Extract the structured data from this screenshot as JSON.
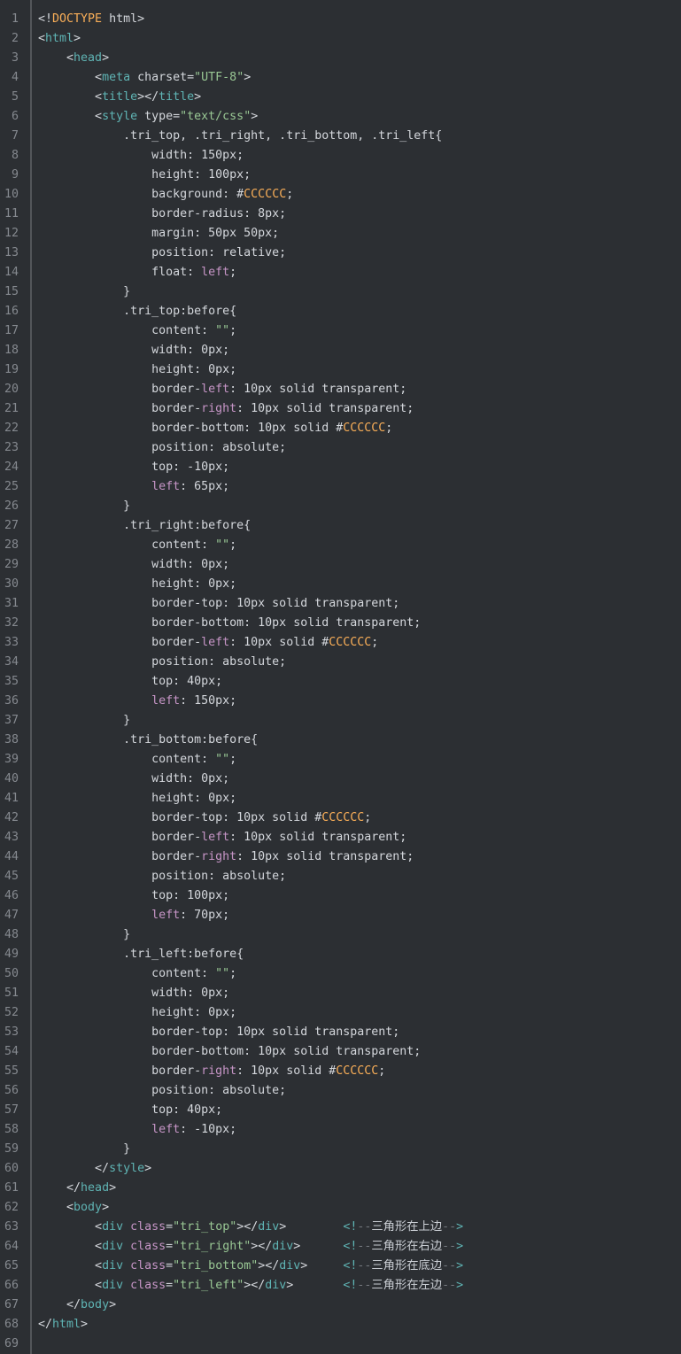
{
  "editor": {
    "colors": {
      "background": "#2c2f33",
      "default_text": "#d4d7dc",
      "tag": "#5fb4b4",
      "string": "#99c794",
      "orange": "#f9ae58",
      "purple": "#c695c6",
      "comment_dash": "#73777d",
      "comment_text": "#c9cdd3",
      "line_number": "#85898f",
      "gutter_divider": "#53565a"
    },
    "lines": [
      {
        "n": "1",
        "tokens": [
          [
            "w",
            "<!"
          ],
          [
            "orn",
            "DOCTYPE"
          ],
          [
            "w",
            " html>"
          ]
        ]
      },
      {
        "n": "2",
        "tokens": [
          [
            "w",
            "<"
          ],
          [
            "tag",
            "html"
          ],
          [
            "w",
            ">"
          ]
        ]
      },
      {
        "n": "3",
        "tokens": [
          [
            "w",
            "    <"
          ],
          [
            "tag",
            "head"
          ],
          [
            "w",
            ">"
          ]
        ]
      },
      {
        "n": "4",
        "tokens": [
          [
            "w",
            "        <"
          ],
          [
            "tag",
            "meta"
          ],
          [
            "w",
            " charset="
          ],
          [
            "str",
            "\"UTF-8\""
          ],
          [
            "w",
            ">"
          ]
        ]
      },
      {
        "n": "5",
        "tokens": [
          [
            "w",
            "        <"
          ],
          [
            "tag",
            "title"
          ],
          [
            "w",
            "></"
          ],
          [
            "tag",
            "title"
          ],
          [
            "w",
            ">"
          ]
        ]
      },
      {
        "n": "6",
        "tokens": [
          [
            "w",
            "        <"
          ],
          [
            "tag",
            "style"
          ],
          [
            "w",
            " type="
          ],
          [
            "str",
            "\"text/css\""
          ],
          [
            "w",
            ">"
          ]
        ]
      },
      {
        "n": "7",
        "tokens": [
          [
            "w",
            "            .tri_top, .tri_right, .tri_bottom, .tri_left{"
          ]
        ]
      },
      {
        "n": "8",
        "tokens": [
          [
            "w",
            "                width: 150px;"
          ]
        ]
      },
      {
        "n": "9",
        "tokens": [
          [
            "w",
            "                height: 100px;"
          ]
        ]
      },
      {
        "n": "10",
        "tokens": [
          [
            "w",
            "                background: #"
          ],
          [
            "orn",
            "CCCCCC"
          ],
          [
            "w",
            ";"
          ]
        ]
      },
      {
        "n": "11",
        "tokens": [
          [
            "w",
            "                border-radius: 8px;"
          ]
        ]
      },
      {
        "n": "12",
        "tokens": [
          [
            "w",
            "                margin: 50px 50px;"
          ]
        ]
      },
      {
        "n": "13",
        "tokens": [
          [
            "w",
            "                position: relative;"
          ]
        ]
      },
      {
        "n": "14",
        "tokens": [
          [
            "w",
            "                float: "
          ],
          [
            "pur",
            "left"
          ],
          [
            "w",
            ";"
          ]
        ]
      },
      {
        "n": "15",
        "tokens": [
          [
            "w",
            "            }"
          ]
        ]
      },
      {
        "n": "16",
        "tokens": [
          [
            "w",
            "            .tri_top:before{"
          ]
        ]
      },
      {
        "n": "17",
        "tokens": [
          [
            "w",
            "                content: "
          ],
          [
            "str",
            "\"\""
          ],
          [
            "w",
            ";"
          ]
        ]
      },
      {
        "n": "18",
        "tokens": [
          [
            "w",
            "                width: 0px;"
          ]
        ]
      },
      {
        "n": "19",
        "tokens": [
          [
            "w",
            "                height: 0px;"
          ]
        ]
      },
      {
        "n": "20",
        "tokens": [
          [
            "w",
            "                border-"
          ],
          [
            "pur",
            "left"
          ],
          [
            "w",
            ": 10px solid transparent;"
          ]
        ]
      },
      {
        "n": "21",
        "tokens": [
          [
            "w",
            "                border-"
          ],
          [
            "pur",
            "right"
          ],
          [
            "w",
            ": 10px solid transparent;"
          ]
        ]
      },
      {
        "n": "22",
        "tokens": [
          [
            "w",
            "                border-bottom: 10px solid #"
          ],
          [
            "orn",
            "CCCCCC"
          ],
          [
            "w",
            ";"
          ]
        ]
      },
      {
        "n": "23",
        "tokens": [
          [
            "w",
            "                position: absolute;"
          ]
        ]
      },
      {
        "n": "24",
        "tokens": [
          [
            "w",
            "                top: -10px;"
          ]
        ]
      },
      {
        "n": "25",
        "tokens": [
          [
            "w",
            "                "
          ],
          [
            "pur",
            "left"
          ],
          [
            "w",
            ": 65px;"
          ]
        ]
      },
      {
        "n": "26",
        "tokens": [
          [
            "w",
            "            }"
          ]
        ]
      },
      {
        "n": "27",
        "tokens": [
          [
            "w",
            "            .tri_right:before{"
          ]
        ]
      },
      {
        "n": "28",
        "tokens": [
          [
            "w",
            "                content: "
          ],
          [
            "str",
            "\"\""
          ],
          [
            "w",
            ";"
          ]
        ]
      },
      {
        "n": "29",
        "tokens": [
          [
            "w",
            "                width: 0px;"
          ]
        ]
      },
      {
        "n": "30",
        "tokens": [
          [
            "w",
            "                height: 0px;"
          ]
        ]
      },
      {
        "n": "31",
        "tokens": [
          [
            "w",
            "                border-top: 10px solid transparent;"
          ]
        ]
      },
      {
        "n": "32",
        "tokens": [
          [
            "w",
            "                border-bottom: 10px solid transparent;"
          ]
        ]
      },
      {
        "n": "33",
        "tokens": [
          [
            "w",
            "                border-"
          ],
          [
            "pur",
            "left"
          ],
          [
            "w",
            ": 10px solid #"
          ],
          [
            "orn",
            "CCCCCC"
          ],
          [
            "w",
            ";"
          ]
        ]
      },
      {
        "n": "34",
        "tokens": [
          [
            "w",
            "                position: absolute;"
          ]
        ]
      },
      {
        "n": "35",
        "tokens": [
          [
            "w",
            "                top: 40px;"
          ]
        ]
      },
      {
        "n": "36",
        "tokens": [
          [
            "w",
            "                "
          ],
          [
            "pur",
            "left"
          ],
          [
            "w",
            ": 150px;"
          ]
        ]
      },
      {
        "n": "37",
        "tokens": [
          [
            "w",
            "            }"
          ]
        ]
      },
      {
        "n": "38",
        "tokens": [
          [
            "w",
            "            .tri_bottom:before{"
          ]
        ]
      },
      {
        "n": "39",
        "tokens": [
          [
            "w",
            "                content: "
          ],
          [
            "str",
            "\"\""
          ],
          [
            "w",
            ";"
          ]
        ]
      },
      {
        "n": "40",
        "tokens": [
          [
            "w",
            "                width: 0px;"
          ]
        ]
      },
      {
        "n": "41",
        "tokens": [
          [
            "w",
            "                height: 0px;"
          ]
        ]
      },
      {
        "n": "42",
        "tokens": [
          [
            "w",
            "                border-top: 10px solid #"
          ],
          [
            "orn",
            "CCCCCC"
          ],
          [
            "w",
            ";"
          ]
        ]
      },
      {
        "n": "43",
        "tokens": [
          [
            "w",
            "                border-"
          ],
          [
            "pur",
            "left"
          ],
          [
            "w",
            ": 10px solid transparent;"
          ]
        ]
      },
      {
        "n": "44",
        "tokens": [
          [
            "w",
            "                border-"
          ],
          [
            "pur",
            "right"
          ],
          [
            "w",
            ": 10px solid transparent;"
          ]
        ]
      },
      {
        "n": "45",
        "tokens": [
          [
            "w",
            "                position: absolute;"
          ]
        ]
      },
      {
        "n": "46",
        "tokens": [
          [
            "w",
            "                top: 100px;"
          ]
        ]
      },
      {
        "n": "47",
        "tokens": [
          [
            "w",
            "                "
          ],
          [
            "pur",
            "left"
          ],
          [
            "w",
            ": 70px;"
          ]
        ]
      },
      {
        "n": "48",
        "tokens": [
          [
            "w",
            "            }"
          ]
        ]
      },
      {
        "n": "49",
        "tokens": [
          [
            "w",
            "            .tri_left:before{"
          ]
        ]
      },
      {
        "n": "50",
        "tokens": [
          [
            "w",
            "                content: "
          ],
          [
            "str",
            "\"\""
          ],
          [
            "w",
            ";"
          ]
        ]
      },
      {
        "n": "51",
        "tokens": [
          [
            "w",
            "                width: 0px;"
          ]
        ]
      },
      {
        "n": "52",
        "tokens": [
          [
            "w",
            "                height: 0px;"
          ]
        ]
      },
      {
        "n": "53",
        "tokens": [
          [
            "w",
            "                border-top: 10px solid transparent;"
          ]
        ]
      },
      {
        "n": "54",
        "tokens": [
          [
            "w",
            "                border-bottom: 10px solid transparent;"
          ]
        ]
      },
      {
        "n": "55",
        "tokens": [
          [
            "w",
            "                border-"
          ],
          [
            "pur",
            "right"
          ],
          [
            "w",
            ": 10px solid #"
          ],
          [
            "orn",
            "CCCCCC"
          ],
          [
            "w",
            ";"
          ]
        ]
      },
      {
        "n": "56",
        "tokens": [
          [
            "w",
            "                position: absolute;"
          ]
        ]
      },
      {
        "n": "57",
        "tokens": [
          [
            "w",
            "                top: 40px;"
          ]
        ]
      },
      {
        "n": "58",
        "tokens": [
          [
            "w",
            "                "
          ],
          [
            "pur",
            "left"
          ],
          [
            "w",
            ": -10px;"
          ]
        ]
      },
      {
        "n": "59",
        "tokens": [
          [
            "w",
            "            }"
          ]
        ]
      },
      {
        "n": "60",
        "tokens": [
          [
            "w",
            "        </"
          ],
          [
            "tag",
            "style"
          ],
          [
            "w",
            ">"
          ]
        ]
      },
      {
        "n": "61",
        "tokens": [
          [
            "w",
            "    </"
          ],
          [
            "tag",
            "head"
          ],
          [
            "w",
            ">"
          ]
        ]
      },
      {
        "n": "62",
        "tokens": [
          [
            "w",
            "    <"
          ],
          [
            "tag",
            "body"
          ],
          [
            "w",
            ">"
          ]
        ]
      },
      {
        "n": "63",
        "tokens": [
          [
            "w",
            "        <"
          ],
          [
            "tag",
            "div"
          ],
          [
            "w",
            " "
          ],
          [
            "pur",
            "class"
          ],
          [
            "w",
            "="
          ],
          [
            "str",
            "\"tri_top\""
          ],
          [
            "w",
            "></"
          ],
          [
            "tag",
            "div"
          ],
          [
            "w",
            ">"
          ],
          [
            "w",
            "        "
          ],
          [
            "tag",
            "<!"
          ],
          [
            "cmt",
            "--"
          ],
          [
            "cmtx",
            "三角形在上边"
          ],
          [
            "cmt",
            "--"
          ],
          [
            "tag",
            ">"
          ]
        ]
      },
      {
        "n": "64",
        "tokens": [
          [
            "w",
            "        <"
          ],
          [
            "tag",
            "div"
          ],
          [
            "w",
            " "
          ],
          [
            "pur",
            "class"
          ],
          [
            "w",
            "="
          ],
          [
            "str",
            "\"tri_right\""
          ],
          [
            "w",
            "></"
          ],
          [
            "tag",
            "div"
          ],
          [
            "w",
            ">"
          ],
          [
            "w",
            "      "
          ],
          [
            "tag",
            "<!"
          ],
          [
            "cmt",
            "--"
          ],
          [
            "cmtx",
            "三角形在右边"
          ],
          [
            "cmt",
            "--"
          ],
          [
            "tag",
            ">"
          ]
        ]
      },
      {
        "n": "65",
        "tokens": [
          [
            "w",
            "        <"
          ],
          [
            "tag",
            "div"
          ],
          [
            "w",
            " "
          ],
          [
            "pur",
            "class"
          ],
          [
            "w",
            "="
          ],
          [
            "str",
            "\"tri_bottom\""
          ],
          [
            "w",
            "></"
          ],
          [
            "tag",
            "div"
          ],
          [
            "w",
            ">"
          ],
          [
            "w",
            "     "
          ],
          [
            "tag",
            "<!"
          ],
          [
            "cmt",
            "--"
          ],
          [
            "cmtx",
            "三角形在底边"
          ],
          [
            "cmt",
            "--"
          ],
          [
            "tag",
            ">"
          ]
        ]
      },
      {
        "n": "66",
        "tokens": [
          [
            "w",
            "        <"
          ],
          [
            "tag",
            "div"
          ],
          [
            "w",
            " "
          ],
          [
            "pur",
            "class"
          ],
          [
            "w",
            "="
          ],
          [
            "str",
            "\"tri_left\""
          ],
          [
            "w",
            "></"
          ],
          [
            "tag",
            "div"
          ],
          [
            "w",
            ">"
          ],
          [
            "w",
            "       "
          ],
          [
            "tag",
            "<!"
          ],
          [
            "cmt",
            "--"
          ],
          [
            "cmtx",
            "三角形在左边"
          ],
          [
            "cmt",
            "--"
          ],
          [
            "tag",
            ">"
          ]
        ]
      },
      {
        "n": "67",
        "tokens": [
          [
            "w",
            "    </"
          ],
          [
            "tag",
            "body"
          ],
          [
            "w",
            ">"
          ]
        ]
      },
      {
        "n": "68",
        "tokens": [
          [
            "w",
            "</"
          ],
          [
            "tag",
            "html"
          ],
          [
            "w",
            ">"
          ]
        ]
      },
      {
        "n": "69",
        "tokens": []
      }
    ]
  }
}
